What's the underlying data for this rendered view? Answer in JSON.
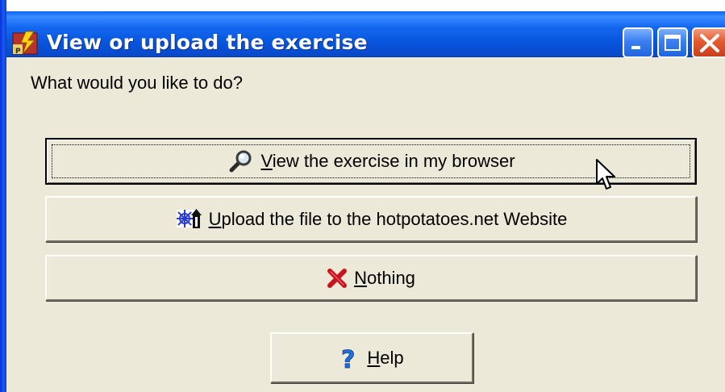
{
  "window": {
    "title": "View or upload the exercise",
    "app_icon": "hotpotatoes-app-icon",
    "controls": {
      "minimize_icon": "minimize-icon",
      "maximize_icon": "maximize-icon",
      "close_icon": "close-icon"
    }
  },
  "dialog": {
    "prompt": "What would you like to do?",
    "buttons": [
      {
        "id": "view",
        "icon": "magnifier-icon",
        "mnemonic": "V",
        "label_rest": "iew the exercise in my browser"
      },
      {
        "id": "upload",
        "icon": "upload-web-icon",
        "mnemonic": "U",
        "label_rest": "pload the file to the hotpotatoes.net Website"
      },
      {
        "id": "nothing",
        "icon": "red-x-icon",
        "mnemonic": "N",
        "label_rest": "othing"
      },
      {
        "id": "help",
        "icon": "question-mark-icon",
        "mnemonic": "H",
        "label_rest": "elp"
      }
    ]
  },
  "colors": {
    "titlebar": "#0855dd",
    "dialog_bg": "#ece9d8",
    "close_button": "#e25b30",
    "nothing_icon": "#c8141e",
    "help_icon": "#1f6fd8"
  }
}
